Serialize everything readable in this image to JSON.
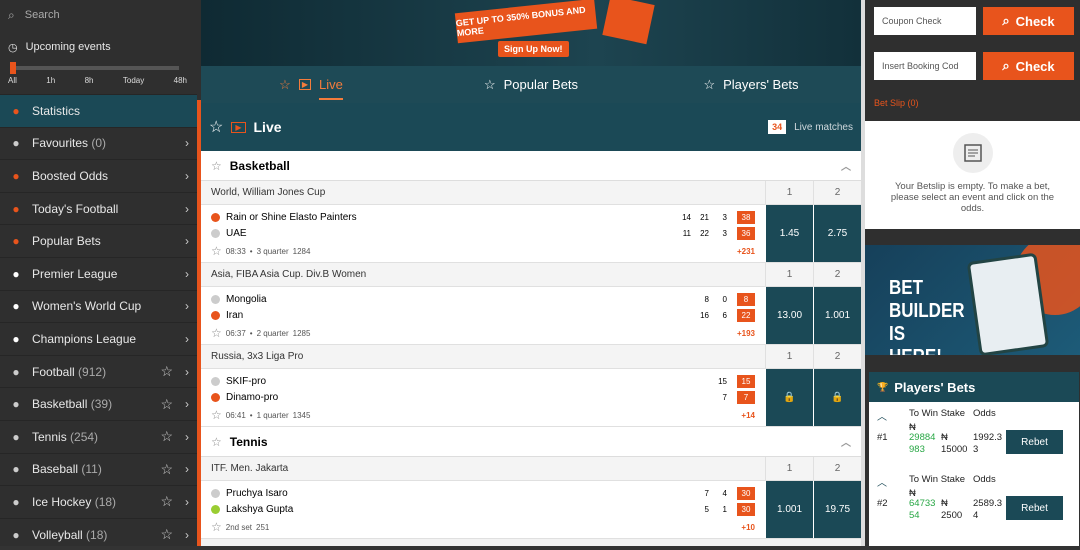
{
  "sidebar": {
    "search_placeholder": "Search",
    "upcoming_label": "Upcoming events",
    "time_ticks": [
      "All",
      "1h",
      "8h",
      "Today",
      "48h"
    ],
    "items": [
      {
        "label": "Statistics",
        "count": "",
        "icon": "chart-icon",
        "color": "#e8541c",
        "star": false,
        "active": true
      },
      {
        "label": "Favourites",
        "count": "(0)",
        "icon": "star-icon",
        "color": "#cccccc",
        "star": false
      },
      {
        "label": "Boosted Odds",
        "count": "",
        "icon": "boost-icon",
        "color": "#e8541c",
        "star": false
      },
      {
        "label": "Today's Football",
        "count": "",
        "icon": "football-icon",
        "color": "#e8541c",
        "star": false
      },
      {
        "label": "Popular Bets",
        "count": "",
        "icon": "fire-icon",
        "color": "#e8541c",
        "star": false
      },
      {
        "label": "Premier League",
        "count": "",
        "icon": "premier-league-icon",
        "color": "#ffffff",
        "star": false
      },
      {
        "label": "Women's World Cup",
        "count": "",
        "icon": "world-cup-icon",
        "color": "#ffffff",
        "star": false
      },
      {
        "label": "Champions League",
        "count": "",
        "icon": "champions-league-icon",
        "color": "#ffffff",
        "star": false
      },
      {
        "label": "Football",
        "count": "(912)",
        "icon": "football-icon",
        "color": "#cccccc",
        "star": true
      },
      {
        "label": "Basketball",
        "count": "(39)",
        "icon": "basketball-icon",
        "color": "#cccccc",
        "star": true
      },
      {
        "label": "Tennis",
        "count": "(254)",
        "icon": "tennis-icon",
        "color": "#cccccc",
        "star": true
      },
      {
        "label": "Baseball",
        "count": "(11)",
        "icon": "baseball-icon",
        "color": "#cccccc",
        "star": true
      },
      {
        "label": "Ice Hockey",
        "count": "(18)",
        "icon": "hockey-icon",
        "color": "#cccccc",
        "star": true
      },
      {
        "label": "Volleyball",
        "count": "(18)",
        "icon": "volleyball-icon",
        "color": "#cccccc",
        "star": true
      }
    ]
  },
  "banner": {
    "promo_text": "GET UP TO 350% BONUS AND MORE",
    "signup_label": "Sign Up Now!"
  },
  "tabs": [
    {
      "label": "Live",
      "active": true
    },
    {
      "label": "Popular Bets",
      "active": false
    },
    {
      "label": "Players' Bets",
      "active": false
    }
  ],
  "live": {
    "title": "Live",
    "count": "34",
    "count_label": "Live matches"
  },
  "sections": [
    {
      "sport": "Basketball",
      "leagues": [
        {
          "name": "World, William Jones Cup",
          "odd_headers": [
            "1",
            "2"
          ],
          "match": {
            "teams": [
              {
                "name": "Rain or Shine Elasto Painters",
                "scores": [
                  "14",
                  "21",
                  "3"
                ],
                "total": "38",
                "dot": "#e8541c"
              },
              {
                "name": "UAE",
                "scores": [
                  "11",
                  "22",
                  "3"
                ],
                "total": "36",
                "dot": "#cccccc"
              }
            ],
            "time": "08:33",
            "period": "3 quarter",
            "id": "1284",
            "more": "+231",
            "odds": [
              "1.45",
              "2.75"
            ]
          }
        },
        {
          "name": "Asia, FIBA Asia Cup. Div.B Women",
          "odd_headers": [
            "1",
            "2"
          ],
          "match": {
            "teams": [
              {
                "name": "Mongolia",
                "scores": [
                  "8",
                  "0"
                ],
                "total": "8",
                "dot": "#cccccc"
              },
              {
                "name": "Iran",
                "scores": [
                  "16",
                  "6"
                ],
                "total": "22",
                "dot": "#e8541c"
              }
            ],
            "time": "06:37",
            "period": "2 quarter",
            "id": "1285",
            "more": "+193",
            "odds": [
              "13.00",
              "1.001"
            ]
          }
        },
        {
          "name": "Russia, 3x3 Liga Pro",
          "odd_headers": [
            "1",
            "2"
          ],
          "match": {
            "teams": [
              {
                "name": "SKIF-pro",
                "scores": [
                  "15"
                ],
                "total": "15",
                "dot": "#cccccc"
              },
              {
                "name": "Dinamo-pro",
                "scores": [
                  "7"
                ],
                "total": "7",
                "dot": "#e8541c"
              }
            ],
            "time": "06:41",
            "period": "1 quarter",
            "id": "1345",
            "more": "+14",
            "odds": [
              "🔒",
              "🔒"
            ]
          }
        }
      ]
    },
    {
      "sport": "Tennis",
      "leagues": [
        {
          "name": "ITF. Men. Jakarta",
          "odd_headers": [
            "1",
            "2"
          ],
          "match": {
            "teams": [
              {
                "name": "Pruchya Isaro",
                "scores": [
                  "7",
                  "4"
                ],
                "total": "30",
                "dot": "#cccccc"
              },
              {
                "name": "Lakshya Gupta",
                "scores": [
                  "5",
                  "1"
                ],
                "total": "30",
                "dot": "#9acd32"
              }
            ],
            "time": "",
            "period": "2nd set",
            "id": "251",
            "more": "+10",
            "odds": [
              "1.001",
              "19.75"
            ]
          }
        }
      ]
    }
  ],
  "right": {
    "coupon_placeholder": "Coupon Check",
    "booking_placeholder": "Insert Booking Cod",
    "check_label": "Check",
    "betslip_label": "Bet Slip (0)",
    "betslip_msg": "Your Betslip is empty. To make a bet, please select an event and click on the odds.",
    "bet_builder": "BET BUILDER IS HERE!",
    "players_bets_title": "Players' Bets",
    "players_bets": [
      {
        "idx": "#1",
        "h1": "To Win",
        "h2": "Stake",
        "h3": "Odds",
        "naira": "₦",
        "win": "29884 983",
        "stake": "15000",
        "odds": "1992.3 3",
        "rebet": "Rebet"
      },
      {
        "idx": "#2",
        "h1": "To Win",
        "h2": "Stake",
        "h3": "Odds",
        "naira": "₦",
        "win": "64733 54",
        "stake": "2500",
        "odds": "2589.3 4",
        "rebet": "Rebet"
      }
    ]
  }
}
